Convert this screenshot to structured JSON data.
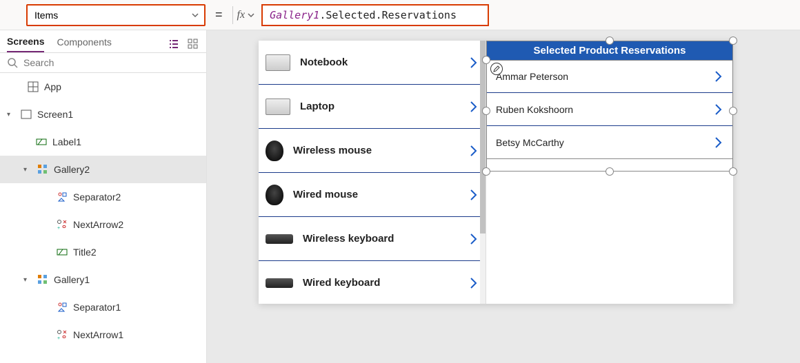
{
  "formula_bar": {
    "property": "Items",
    "equals": "=",
    "fx": "fx",
    "formula_ident": "Gallery1",
    "formula_rest": ".Selected.Reservations"
  },
  "panel": {
    "tab_screens": "Screens",
    "tab_components": "Components",
    "search_placeholder": "Search"
  },
  "tree": {
    "app": "App",
    "screen1": "Screen1",
    "label1": "Label1",
    "gallery2": "Gallery2",
    "separator2": "Separator2",
    "nextarrow2": "NextArrow2",
    "title2": "Title2",
    "gallery1": "Gallery1",
    "separator1": "Separator1",
    "nextarrow1": "NextArrow1"
  },
  "gallery1": {
    "items": [
      {
        "label": "Notebook",
        "kind": "laptop"
      },
      {
        "label": "Laptop",
        "kind": "laptop"
      },
      {
        "label": "Wireless mouse",
        "kind": "mouse"
      },
      {
        "label": "Wired mouse",
        "kind": "mouse"
      },
      {
        "label": "Wireless keyboard",
        "kind": "kbd"
      },
      {
        "label": "Wired keyboard",
        "kind": "kbd"
      }
    ]
  },
  "gallery2": {
    "header": "Selected Product Reservations",
    "items": [
      "Ammar Peterson",
      "Ruben Kokshoorn",
      "Betsy McCarthy"
    ]
  }
}
